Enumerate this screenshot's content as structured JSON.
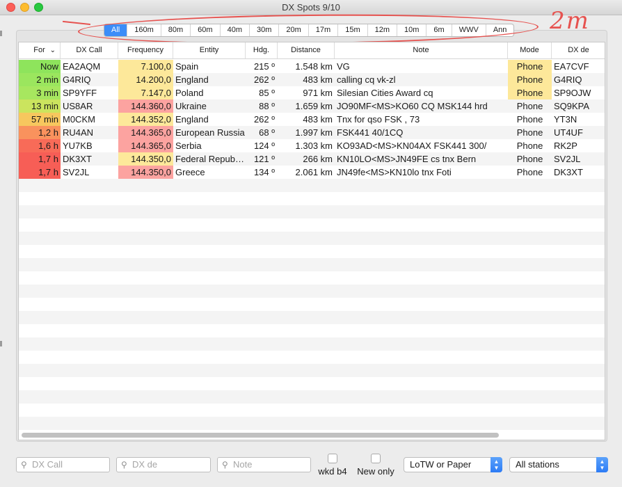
{
  "window": {
    "title": "DX Spots 9/10"
  },
  "bands": [
    {
      "label": "All",
      "active": true
    },
    {
      "label": "160m"
    },
    {
      "label": "80m"
    },
    {
      "label": "60m"
    },
    {
      "label": "40m"
    },
    {
      "label": "30m"
    },
    {
      "label": "20m"
    },
    {
      "label": "17m"
    },
    {
      "label": "15m"
    },
    {
      "label": "12m"
    },
    {
      "label": "10m"
    },
    {
      "label": "6m"
    },
    {
      "label": "WWV"
    },
    {
      "label": "Ann"
    }
  ],
  "annotation": {
    "text": "2m",
    "color": "#e6524f"
  },
  "table": {
    "headers": [
      "For",
      "DX Call",
      "Frequency",
      "Entity",
      "Hdg.",
      "Distance",
      "Note",
      "Mode",
      "DX de"
    ],
    "rows": [
      {
        "for": "Now",
        "call": "EA2AQM",
        "freq": "7.100,0",
        "entity": "Spain",
        "hdg": "215 º",
        "dist": "1.548 km",
        "note": "VG",
        "mode": "Phone",
        "dxde": "EA7CVF",
        "for_color": "#8ee45c",
        "freq_color": "#fde89a",
        "mode_color": "#fde89a"
      },
      {
        "for": "2 min",
        "call": "G4RIQ",
        "freq": "14.200,0",
        "entity": "England",
        "hdg": "262 º",
        "dist": "483 km",
        "note": "calling cq vk-zl",
        "mode": "Phone",
        "dxde": "G4RIQ",
        "for_color": "#9be65e",
        "freq_color": "#fde89a",
        "mode_color": "#fde89a"
      },
      {
        "for": "3 min",
        "call": "SP9YFF",
        "freq": "7.147,0",
        "entity": "Poland",
        "hdg": "85 º",
        "dist": "971 km",
        "note": "Silesian Cities Award cq",
        "mode": "Phone",
        "dxde": "SP9OJW",
        "for_color": "#a7e75f",
        "freq_color": "#fde89a",
        "mode_color": "#fde89a"
      },
      {
        "for": "13 min",
        "call": "US8AR",
        "freq": "144.360,0",
        "entity": "Ukraine",
        "hdg": "88 º",
        "dist": "1.659 km",
        "note": "JO90MF<MS>KO60 CQ MSK144 hrd",
        "mode": "Phone",
        "dxde": "SQ9KPA",
        "for_color": "#cbe45e",
        "freq_color": "#fca3a0",
        "mode_color": ""
      },
      {
        "for": "57 min",
        "call": "M0CKM",
        "freq": "144.352,0",
        "entity": "England",
        "hdg": "262 º",
        "dist": "483 km",
        "note": "Tnx for qso FSK , 73",
        "mode": "Phone",
        "dxde": "YT3N",
        "for_color": "#f7c75e",
        "freq_color": "#fde89a",
        "mode_color": ""
      },
      {
        "for": "1,2 h",
        "call": "RU4AN",
        "freq": "144.365,0",
        "entity": "European Russia",
        "hdg": "68 º",
        "dist": "1.997 km",
        "note": "FSK441 40/1CQ",
        "mode": "Phone",
        "dxde": "UT4UF",
        "for_color": "#f9925d",
        "freq_color": "#fca3a0",
        "mode_color": ""
      },
      {
        "for": "1,6 h",
        "call": "YU7KB",
        "freq": "144.365,0",
        "entity": "Serbia",
        "hdg": "124 º",
        "dist": "1.303 km",
        "note": "KO93AD<MS>KN04AX FSK441 300/",
        "mode": "Phone",
        "dxde": "RK2P",
        "for_color": "#f86b58",
        "freq_color": "#fca3a0",
        "mode_color": ""
      },
      {
        "for": "1,7 h",
        "call": "DK3XT",
        "freq": "144.350,0",
        "entity": "Federal Repub…",
        "hdg": "121 º",
        "dist": "266 km",
        "note": "KN10LO<MS>JN49FE cs tnx Bern",
        "mode": "Phone",
        "dxde": "SV2JL",
        "for_color": "#f75e56",
        "freq_color": "#fde89a",
        "mode_color": ""
      },
      {
        "for": "1,7 h",
        "call": "SV2JL",
        "freq": "144.350,0",
        "entity": "Greece",
        "hdg": "134 º",
        "dist": "2.061 km",
        "note": "JN49fe<MS>KN10lo tnx Foti",
        "mode": "Phone",
        "dxde": "DK3XT",
        "for_color": "#f75e56",
        "freq_color": "#fca3a0",
        "mode_color": ""
      }
    ]
  },
  "filters": {
    "dx_call_placeholder": "DX Call",
    "dx_de_placeholder": "DX de",
    "note_placeholder": "Note",
    "wkd_b4_label": "wkd b4",
    "new_only_label": "New only",
    "lotw_selected": "LoTW or Paper",
    "stations_selected": "All stations"
  }
}
